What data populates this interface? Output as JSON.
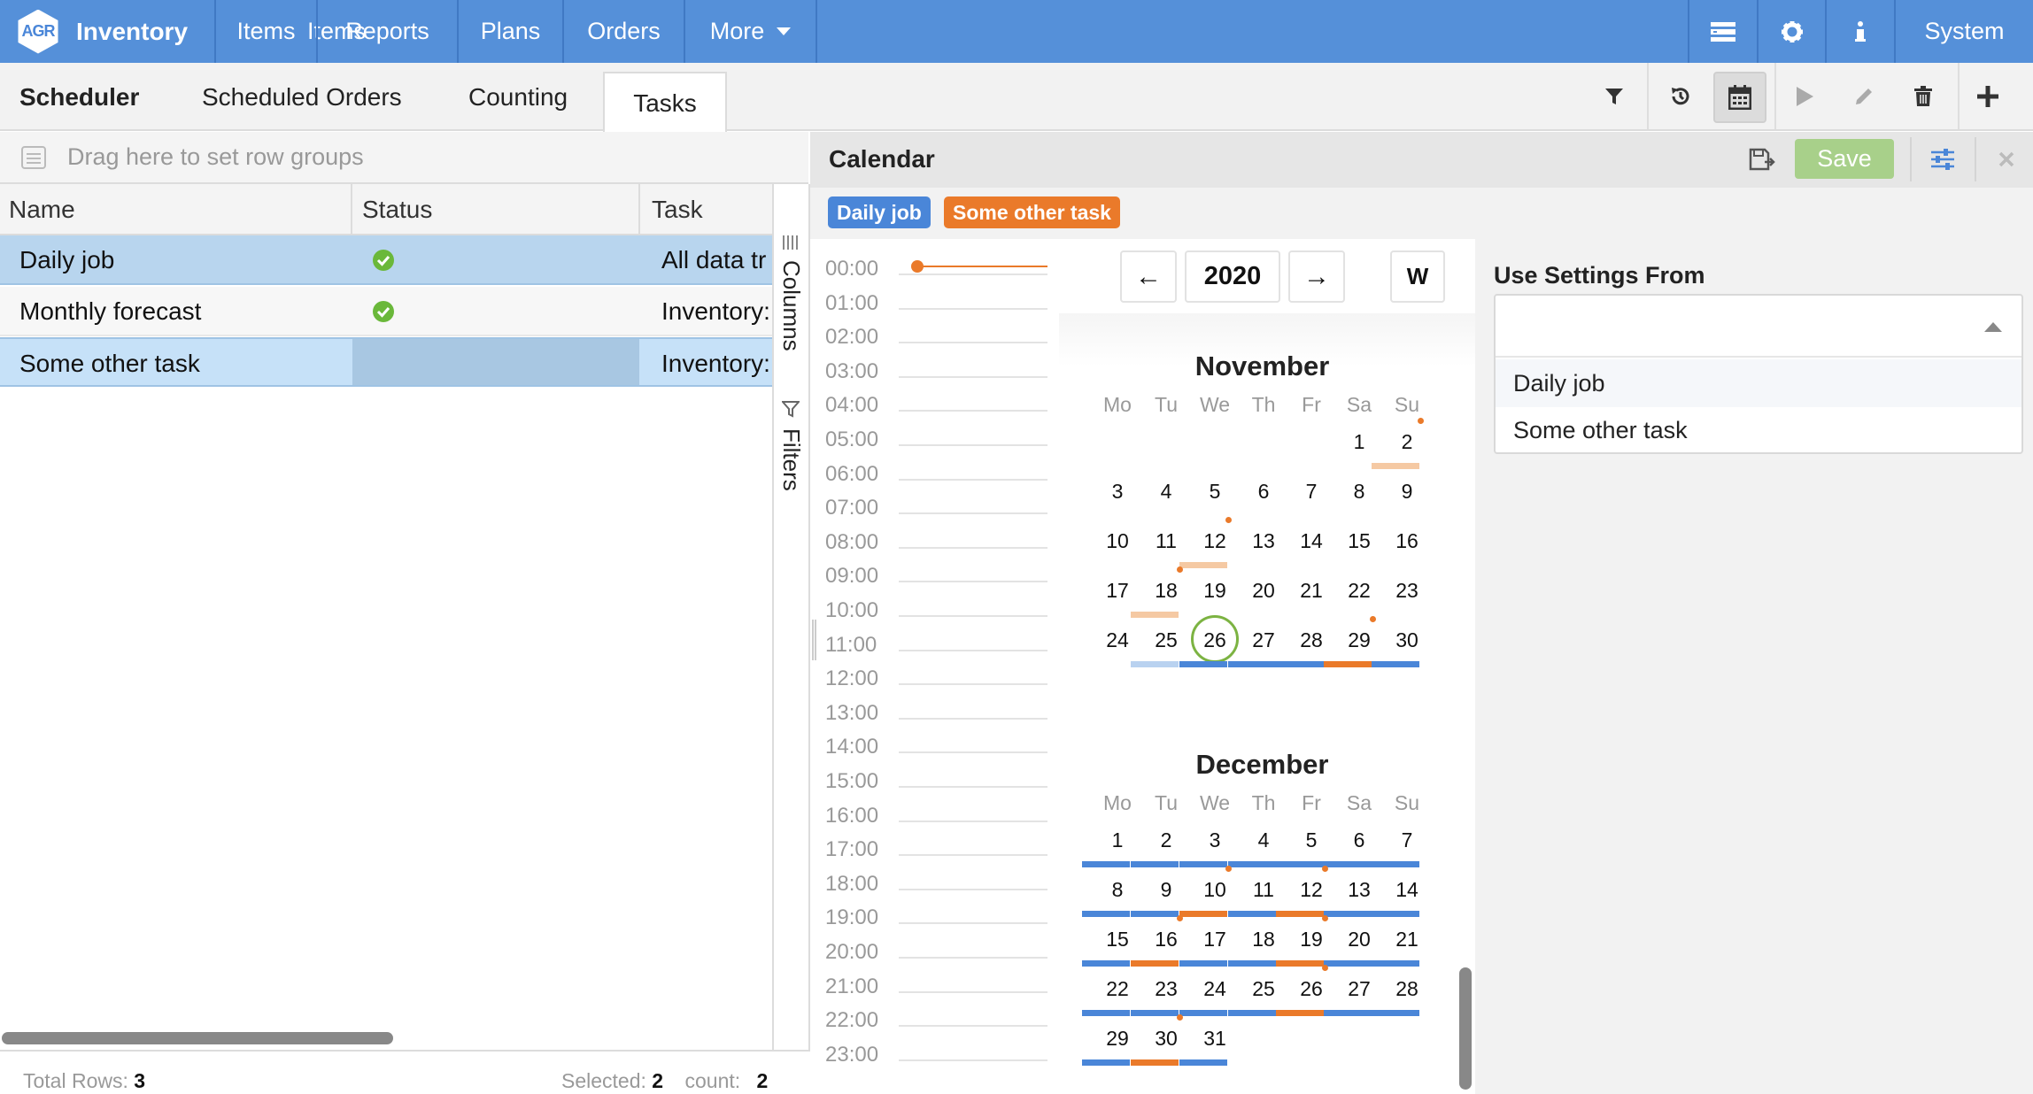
{
  "app": {
    "logo_text": "AGR",
    "title": "Inventory"
  },
  "nav": {
    "items": [
      "Items",
      "Reports",
      "Plans",
      "Orders",
      "More"
    ],
    "system_label": "System",
    "icons": [
      "list-icon",
      "gear-icon",
      "info-icon"
    ]
  },
  "subnav": {
    "title": "Scheduler",
    "tabs": [
      "Scheduled Orders",
      "Counting",
      "Tasks"
    ],
    "active_tab": "Tasks",
    "tools": [
      "filter-icon",
      "history-icon",
      "calendar-icon",
      "play-icon",
      "pencil-icon",
      "trash-icon",
      "plus-icon"
    ]
  },
  "grid": {
    "row_group_placeholder": "Drag here to set row groups",
    "columns": [
      "Name",
      "Status",
      "Task"
    ],
    "rows": [
      {
        "name": "Daily job",
        "status": "ok",
        "task": "All data tr"
      },
      {
        "name": "Monthly forecast",
        "status": "ok",
        "task": "Inventory:"
      },
      {
        "name": "Some other task",
        "status": "",
        "task": "Inventory:"
      }
    ],
    "side_tabs": [
      "Columns",
      "Filters"
    ],
    "footer": {
      "total_rows_label": "Total Rows:",
      "total_rows": "3",
      "selected_label": "Selected:",
      "selected": "2",
      "count_label": "count:",
      "count": "2"
    }
  },
  "calendar": {
    "title": "Calendar",
    "save_label": "Save",
    "tags": [
      {
        "label": "Daily job",
        "color": "#4a86d8"
      },
      {
        "label": "Some other task",
        "color": "#ea7a2a"
      }
    ],
    "hours": [
      "00:00",
      "01:00",
      "02:00",
      "03:00",
      "04:00",
      "05:00",
      "06:00",
      "07:00",
      "08:00",
      "09:00",
      "10:00",
      "11:00",
      "12:00",
      "13:00",
      "14:00",
      "15:00",
      "16:00",
      "17:00",
      "18:00",
      "19:00",
      "20:00",
      "21:00",
      "22:00",
      "23:00"
    ],
    "year": "2020",
    "prev_label": "←",
    "next_label": "→",
    "view_label": "W",
    "weekdays": [
      "Mo",
      "Tu",
      "We",
      "Th",
      "Fr",
      "Sa",
      "Su"
    ],
    "months": [
      {
        "name": "November",
        "first_weekday": 6,
        "days": 30,
        "today": 26
      },
      {
        "name": "December",
        "first_weekday": 1,
        "days": 31
      }
    ],
    "settings_label": "Use Settings From",
    "settings_options": [
      "Daily job",
      "Some other task"
    ],
    "colors": {
      "daily": "#4a86d8",
      "other": "#ea7a2a",
      "other_light": "#f5c9a3",
      "daily_light": "#b9d2f0",
      "today_ring": "#7cb342"
    }
  }
}
